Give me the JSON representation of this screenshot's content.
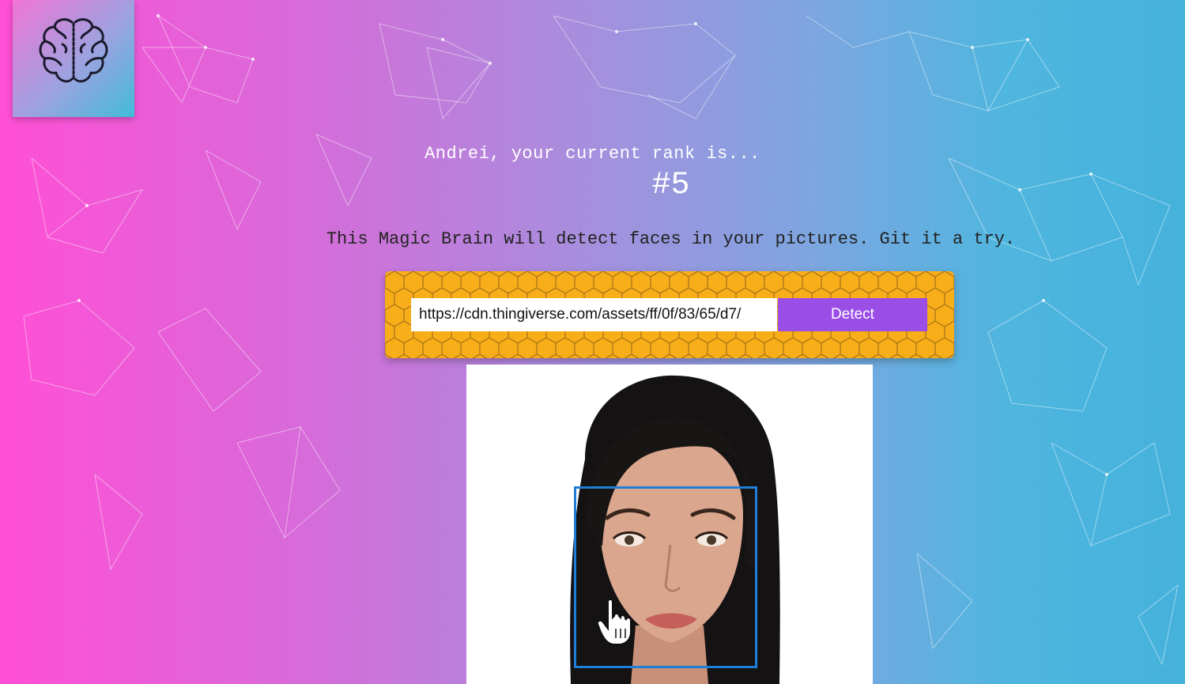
{
  "header": {
    "logo_icon": "brain-icon"
  },
  "rank": {
    "message": "Andrei, your current rank is...",
    "value": "#5"
  },
  "tagline": "This Magic Brain will detect faces in your pictures. Git it a try.",
  "form": {
    "url_value": "https://cdn.thingiverse.com/assets/ff/0f/83/65/d7/",
    "detect_label": "Detect"
  },
  "result": {
    "image_description": "portrait photo",
    "face_box_visible": true,
    "box_color": "#1f7fd8"
  },
  "colors": {
    "accent_button": "#9a4ee6",
    "panel_yellow": "#f7ae18"
  }
}
